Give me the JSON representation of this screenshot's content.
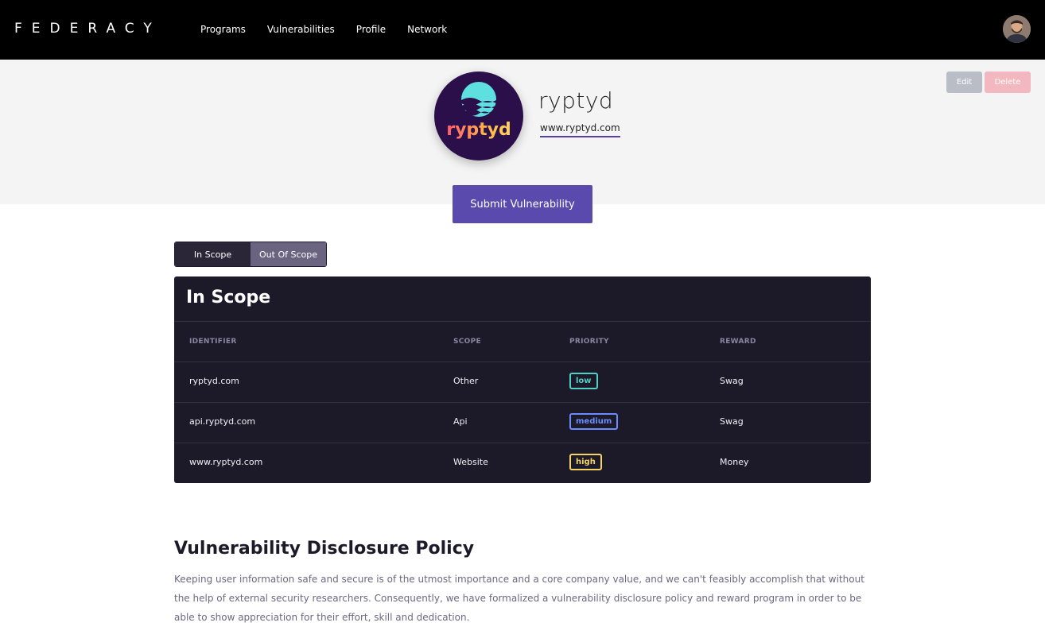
{
  "nav": {
    "logo": "FEDERACY",
    "links": [
      "Programs",
      "Vulnerabilities",
      "Profile",
      "Network"
    ]
  },
  "org": {
    "name": "ryptyd",
    "url": "www.ryptyd.com",
    "logo_text": "ryptyd"
  },
  "actions": {
    "edit": "Edit",
    "delete": "Delete",
    "submit": "Submit Vulnerability"
  },
  "tabs": {
    "in_scope": "In Scope",
    "out_of_scope": "Out Of Scope"
  },
  "scope_table": {
    "title": "In Scope",
    "headers": [
      "IDENTIFIER",
      "SCOPE",
      "PRIORITY",
      "REWARD"
    ],
    "rows": [
      {
        "identifier": "ryptyd.com",
        "scope": "Other",
        "priority": "low",
        "reward": "Swag"
      },
      {
        "identifier": "api.ryptyd.com",
        "scope": "Api",
        "priority": "medium",
        "reward": "Swag"
      },
      {
        "identifier": "www.ryptyd.com",
        "scope": "Website",
        "priority": "high",
        "reward": "Money"
      }
    ]
  },
  "priority_colors": {
    "low": "#4fd1c5",
    "medium": "#6b8cff",
    "high": "#f6d365"
  },
  "policy": {
    "title": "Vulnerability Disclosure Policy",
    "text": "Keeping user information safe and secure is of the utmost importance and a core company value, and we can't feasibly accomplish that without the help of external security researchers. Consequently, we have formalized a vulnerability disclosure policy and reward program in order to be able to show appreciation for their effort, skill and dedication."
  }
}
